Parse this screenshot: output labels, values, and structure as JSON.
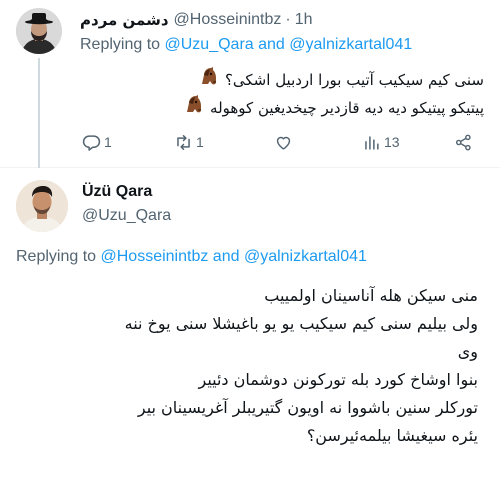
{
  "tweet1": {
    "display_name": "دشمن مردم",
    "handle": "@Hosseinintbz",
    "separator": "·",
    "time": "1h",
    "replying_prefix": "Replying to",
    "replying_user1": "@Uzu_Qara",
    "replying_and": "and",
    "replying_user2": "@yalnizkartal041",
    "text_lines": [
      "سنی کیم سیکیب آتیب بورا اردبیل اشکی؟",
      "پیتیکو پیتیکو دیه دیه قازدیر چیخدیغین کوهوله"
    ],
    "emoji": "horse-face",
    "actions": {
      "reply_count": "1",
      "retweet_count": "1",
      "like_count": "",
      "views_count": "13"
    }
  },
  "tweet2": {
    "display_name": "Üzü Qara",
    "handle": "@Uzu_Qara",
    "replying_prefix": "Replying to",
    "replying_user1": "@Hosseinintbz",
    "replying_and": "and",
    "replying_user2": "@yalnizkartal041",
    "text_lines": [
      "منی سیکن هله آناسینان اولمییب",
      "ولی بیلیم سنی کیم سیکیب یو یو باغیشلا سنی یوخ ننه",
      "وی",
      "بنوا اوشاخ کورد بله تورکونن دوشمان دئییر",
      "تورکلر سنین باشووا نه اویون گتیریبلر آغریسینان بیر",
      "یئره سیغیشا بیلمه‌ئیرسن؟"
    ]
  },
  "colors": {
    "link": "#1d9bf0",
    "secondary_text": "#536471",
    "primary_text": "#0f1419",
    "divider": "#eff3f4"
  }
}
